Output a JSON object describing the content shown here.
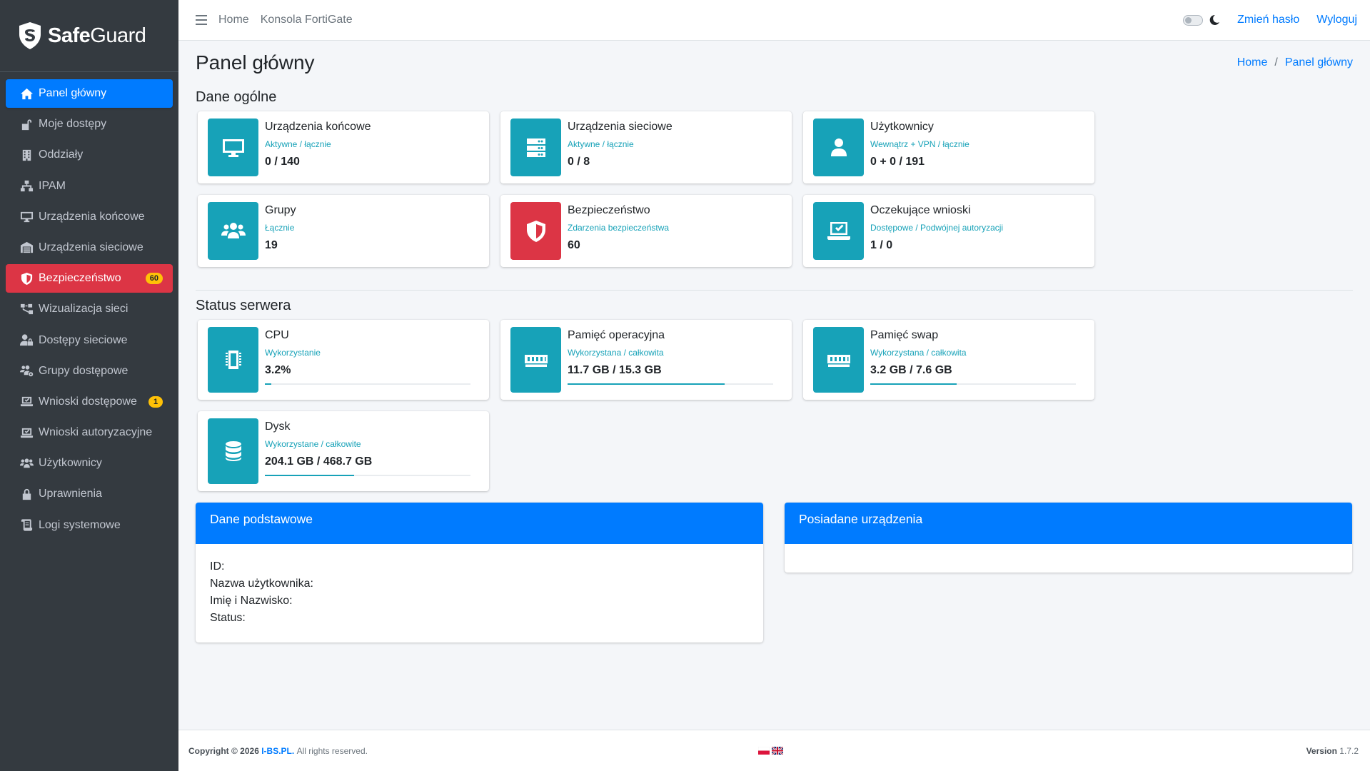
{
  "app": {
    "brand": "SafeGuard",
    "brand_bold": "Safe",
    "brand_rest": "Guard"
  },
  "sidebar": {
    "items": [
      {
        "label": "Panel główny",
        "icon": "home-icon",
        "state": "active"
      },
      {
        "label": "Moje dostępy",
        "icon": "unlock-icon"
      },
      {
        "label": "Oddziały",
        "icon": "building-icon"
      },
      {
        "label": "IPAM",
        "icon": "network-icon"
      },
      {
        "label": "Urządzenia końcowe",
        "icon": "desktop-icon"
      },
      {
        "label": "Urządzenia sieciowe",
        "icon": "warehouse-icon"
      },
      {
        "label": "Bezpieczeństwo",
        "icon": "shield-icon",
        "state": "danger",
        "badge": "60"
      },
      {
        "label": "Wizualizacja sieci",
        "icon": "diagram-icon"
      },
      {
        "label": "Dostępy sieciowe",
        "icon": "user-lock-icon"
      },
      {
        "label": "Grupy dostępowe",
        "icon": "users-cog-icon"
      },
      {
        "label": "Wnioski dostępowe",
        "icon": "laptop-check-icon",
        "badge": "1"
      },
      {
        "label": "Wnioski autoryzacyjne",
        "icon": "laptop-check-icon"
      },
      {
        "label": "Użytkownicy",
        "icon": "users-icon"
      },
      {
        "label": "Uprawnienia",
        "icon": "lock-icon"
      },
      {
        "label": "Logi systemowe",
        "icon": "scroll-icon"
      }
    ]
  },
  "topbar": {
    "links": [
      "Home",
      "Konsola FortiGate"
    ],
    "change_password": "Zmień hasło",
    "logout": "Wyloguj"
  },
  "page": {
    "title": "Panel główny",
    "breadcrumb": [
      "Home",
      "/",
      "Panel główny"
    ]
  },
  "general": {
    "title": "Dane ogólne",
    "boxes": [
      {
        "title": "Urządzenia końcowe",
        "sub": "Aktywne / łącznie",
        "value": "0 / 140",
        "icon": "desktop-icon"
      },
      {
        "title": "Urządzenia sieciowe",
        "sub": "Aktywne / łącznie",
        "value": "0 / 8",
        "icon": "server-icon"
      },
      {
        "title": "Użytkownicy",
        "sub": "Wewnątrz + VPN / łącznie",
        "value": "0 + 0 / 191",
        "icon": "user-icon"
      },
      {
        "title": "Grupy",
        "sub": "Łącznie",
        "value": "19",
        "icon": "users-icon"
      },
      {
        "title": "Bezpieczeństwo",
        "sub": "Zdarzenia bezpieczeństwa",
        "value": "60",
        "icon": "shield-icon",
        "color": "#dc3545"
      },
      {
        "title": "Oczekujące wnioski",
        "sub": "Dostępowe / Podwójnej autoryzacji",
        "value": "1 / 0",
        "icon": "laptop-check-icon"
      }
    ]
  },
  "server": {
    "title": "Status serwera",
    "boxes": [
      {
        "title": "CPU",
        "sub": "Wykorzystanie",
        "value": "3.2%",
        "progress": 0.032,
        "icon": "microchip-icon"
      },
      {
        "title": "Pamięć operacyjna",
        "sub": "Wykorzystana / całkowita",
        "value": "11.7 GB / 15.3 GB",
        "progress": 0.765,
        "icon": "memory-icon"
      },
      {
        "title": "Pamięć swap",
        "sub": "Wykorzystana / całkowita",
        "value": "3.2 GB / 7.6 GB",
        "progress": 0.42,
        "icon": "memory-icon"
      },
      {
        "title": "Dysk",
        "sub": "Wykorzystane / całkowite",
        "value": "204.1 GB / 468.7 GB",
        "progress": 0.435,
        "icon": "database-icon"
      }
    ]
  },
  "basic_card": {
    "title": "Dane podstawowe",
    "fields": [
      "ID:",
      "Nazwa użytkownika:",
      "Imię i Nazwisko:",
      "Status:"
    ]
  },
  "devices_card": {
    "title": "Posiadane urządzenia"
  },
  "footer": {
    "copyright": "Copyright © 2026",
    "company": "I-BS.PL.",
    "rights": "All rights reserved.",
    "version_label": "Version",
    "version": "1.7.2"
  },
  "colors": {
    "sidebar_bg": "#343a40",
    "primary": "#007bff",
    "info": "#17a2b8",
    "danger": "#dc3545",
    "warning": "#ffc107"
  }
}
